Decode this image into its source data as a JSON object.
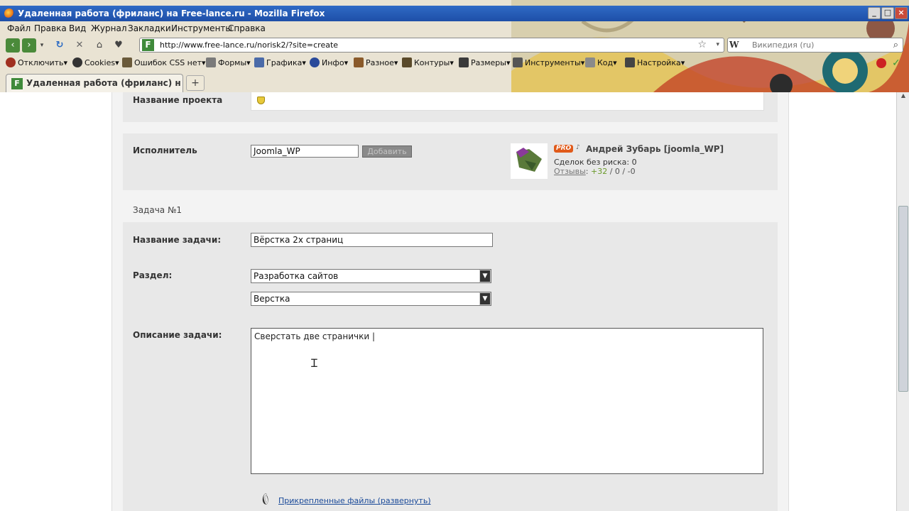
{
  "window": {
    "title": "Удаленная работа (фриланс) на Free-lance.ru - Mozilla Firefox",
    "controls": [
      "_",
      "□",
      "×"
    ]
  },
  "menu": {
    "items": [
      "Файл",
      "Правка",
      "Вид",
      "Журнал",
      "Закладки",
      "Инструменты",
      "Справка"
    ]
  },
  "nav": {
    "url": "http://www.free-lance.ru/norisk2/?site=create",
    "site_icon": "F",
    "search_engine_icon": "W",
    "search_placeholder": "Википедия (ru)"
  },
  "dev_toolbar": {
    "items": [
      "Отключить",
      "Cookies",
      "Ошибок CSS нет",
      "Формы",
      "Графика",
      "Инфо",
      "Разное",
      "Контуры",
      "Размеры",
      "Инструменты",
      "Код",
      "Настройка"
    ],
    "colors": {
      "error_icon": "#cc2222",
      "ok_icon": "#3a9a3a"
    }
  },
  "tab": {
    "label": "Удаленная работа (фриланс) на Fr...",
    "favicon": "F",
    "new_tab": "+"
  },
  "form": {
    "project_name_label": "Название проекта",
    "executor_label": "Исполнитель",
    "executor_value": "Joomla_WP",
    "add_button": "Добавить",
    "user": {
      "badge": "PRO",
      "name": "Андрей Зубарь [joomla_WP]",
      "deals": "Сделок без риска: 0",
      "reviews_label": "Отзывы",
      "reviews_positive": "+32",
      "reviews_sep1": " / ",
      "reviews_neutral": "0",
      "reviews_sep2": " / ",
      "reviews_negative": "-0"
    },
    "task_heading": "Задача №1",
    "task_name_label": "Название задачи:",
    "task_name_value": "Вёрстка 2х страниц",
    "section_label": "Раздел:",
    "section_value": "Разработка сайтов",
    "subsection_value": "Верстка",
    "description_label": "Описание задачи:",
    "description_value": "Сверстать две странички |",
    "attachments_link": "Прикрепленные файлы (развернуть)"
  },
  "colors": {
    "titlebar": "#2458b5",
    "pro_badge": "#e05a1a",
    "reviews_positive": "#6a9a2a",
    "link": "#1a4a99",
    "panel_bg": "#e8e8e8",
    "page_bg": "#f3f3f3"
  }
}
